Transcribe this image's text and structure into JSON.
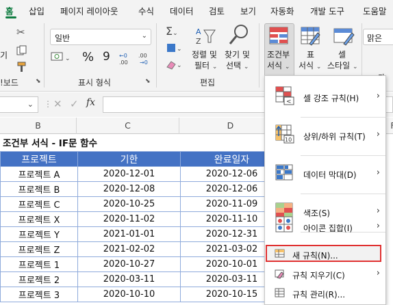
{
  "ribbon_tabs": [
    "홈",
    "삽입",
    "페이지 레이아웃",
    "수식",
    "데이터",
    "검토",
    "보기",
    "자동화",
    "개발 도구",
    "도움말"
  ],
  "clipboard": {
    "paste_fragment": "기",
    "group_label_fragment": "!보드"
  },
  "number": {
    "format_value": "일반",
    "group_label": "표시 형식",
    "symbols": [
      "%",
      "9"
    ]
  },
  "editing": {
    "sort_label_1": "정렬 및",
    "sort_label_2": "필터",
    "find_label_1": "찾기 및",
    "find_label_2": "선택",
    "group_label": "편집"
  },
  "styles": {
    "conditional_label_1": "조건부",
    "conditional_label_2": "서식",
    "table_label_1": "표",
    "table_label_2": "서식",
    "cell_label_1": "셀",
    "cell_label_2": "스타일"
  },
  "font": {
    "name_fragment": "맑은",
    "label_fragment": "가"
  },
  "formula_bar": {
    "fx": "fx"
  },
  "columns": [
    "B",
    "C",
    "D",
    "F"
  ],
  "sheet": {
    "title": "조건부 서식 - IF문 함수",
    "headers": [
      "프로젝트",
      "기한",
      "완료일자"
    ],
    "rows": [
      [
        "프로젝트 A",
        "2020-12-01",
        "2020-12-06"
      ],
      [
        "프로젝트 B",
        "2020-12-08",
        "2020-12-06"
      ],
      [
        "프로젝트 C",
        "2020-10-25",
        "2020-11-09"
      ],
      [
        "프로젝트 X",
        "2020-11-02",
        "2020-11-10"
      ],
      [
        "프로젝트 Y",
        "2021-01-01",
        "2020-12-31"
      ],
      [
        "프로젝트 Z",
        "2021-02-02",
        "2021-03-02"
      ],
      [
        "프로젝트 1",
        "2020-10-27",
        "2020-10-01"
      ],
      [
        "프로젝트 2",
        "2020-03-11",
        "2020-03-11"
      ],
      [
        "프로젝트 3",
        "2020-10-10",
        "2020-10-15"
      ]
    ]
  },
  "menu": {
    "highlight_cells": "셀 강조 규칙(H)",
    "top_bottom": "상위/하위 규칙(T)",
    "data_bars": "데이터 막대(D)",
    "color_scales": "색조(S)",
    "icon_sets": "아이콘 집합(I)",
    "new_rule": "새 규칙(N)...",
    "clear_rules": "규칙 지우기(C)",
    "manage_rules": "규칙 관리(R)..."
  },
  "colors": {
    "accent": "#107c41",
    "table_header": "#4472c4",
    "table_border": "#8eaadb",
    "highlight_outline": "#e03030"
  }
}
